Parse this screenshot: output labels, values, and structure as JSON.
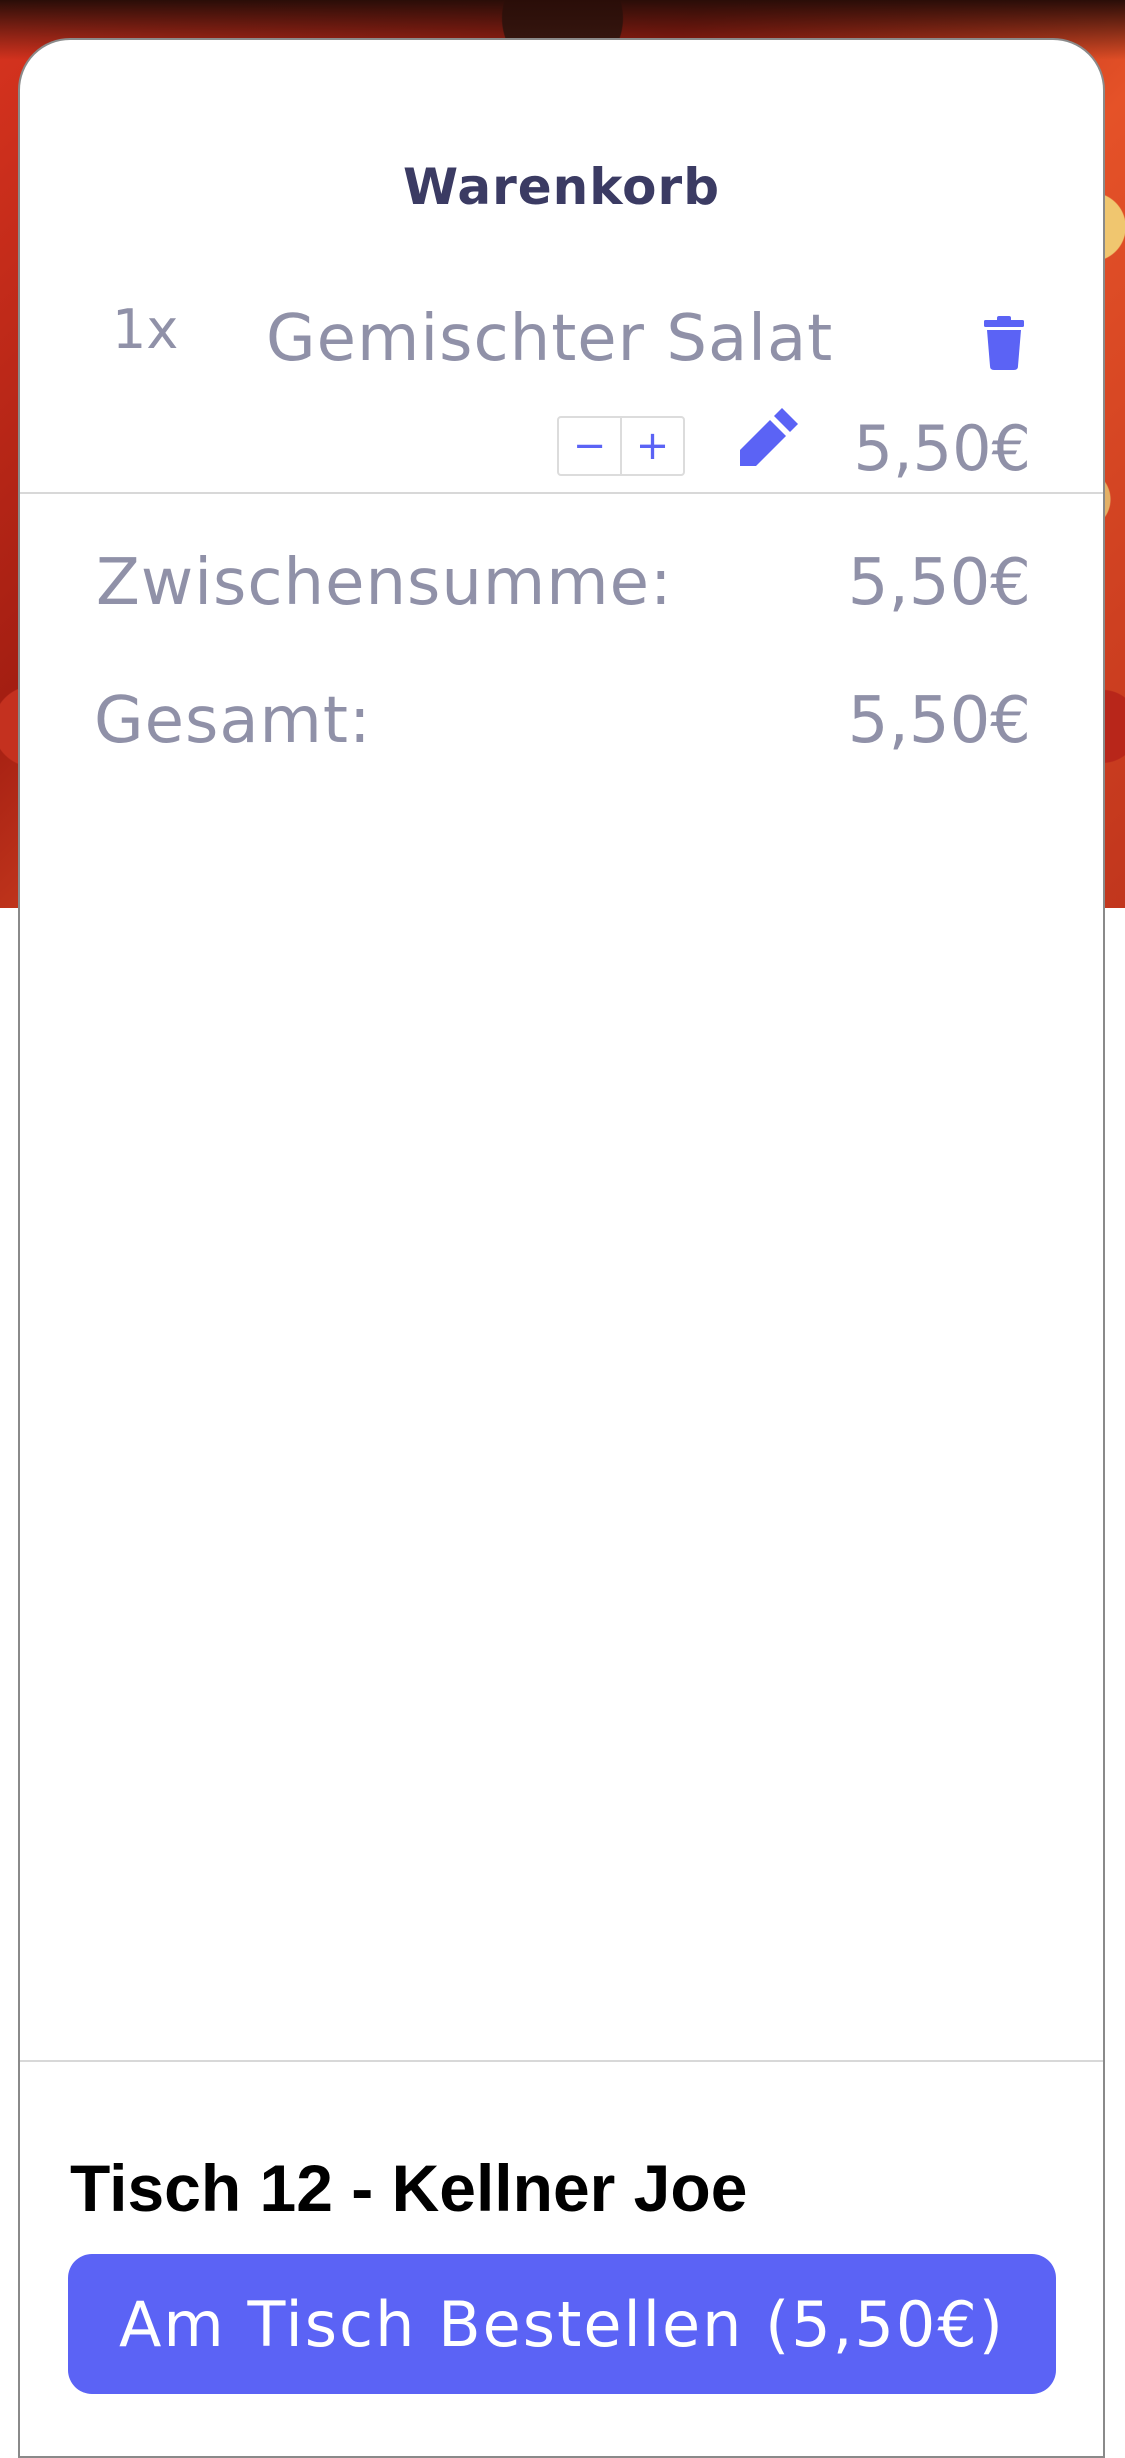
{
  "cart": {
    "title": "Warenkorb",
    "items": [
      {
        "quantity": "1x",
        "name": "Gemischter Salat",
        "price": "5,50€",
        "decrement": "−",
        "increment": "+"
      }
    ]
  },
  "summary": {
    "subtotal_label": "Zwischensumme:",
    "subtotal_value": "5,50€",
    "total_label": "Gesamt:",
    "total_value": "5,50€"
  },
  "footer": {
    "table_info": "Tisch 12 - Kellner Joe",
    "order_button": "Am Tisch Bestellen (5,50€)"
  },
  "icons": {
    "delete": "trash-icon",
    "edit": "pencil-icon"
  },
  "colors": {
    "accent": "#5b63f5",
    "title": "#3b3b63",
    "muted_text": "#9091a8"
  }
}
